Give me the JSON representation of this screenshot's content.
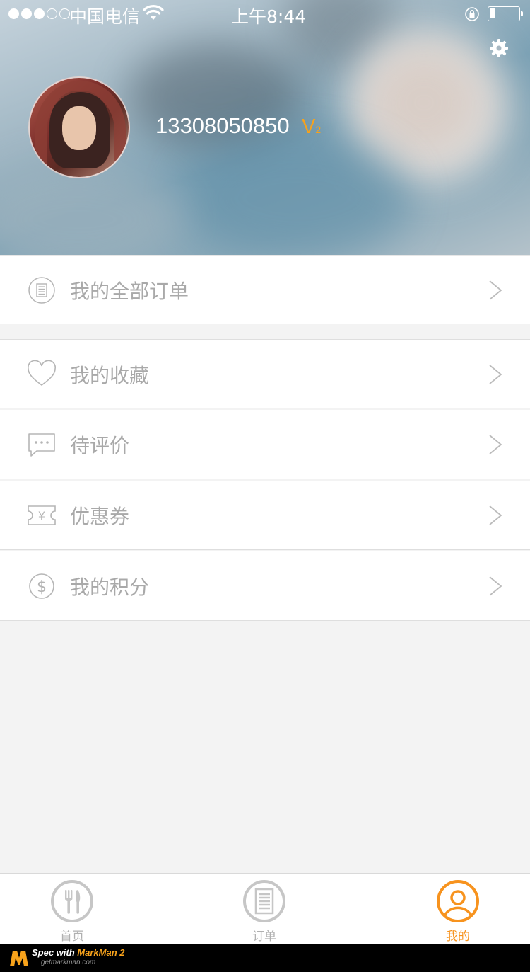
{
  "status_bar": {
    "carrier": "中国电信",
    "time": "上午8:44",
    "signal_bars_filled": 3,
    "signal_bars_total": 5,
    "battery_level": 0.2
  },
  "profile": {
    "phone": "13308050850",
    "vip_letter": "V",
    "vip_level": "2"
  },
  "menu": {
    "all_orders": "我的全部订单",
    "favorites": "我的收藏",
    "to_review": "待评价",
    "coupons": "优惠券",
    "points": "我的积分"
  },
  "tabs": {
    "home": "首页",
    "orders": "订单",
    "mine": "我的",
    "active": "mine"
  },
  "watermark": {
    "spec": "Spec with ",
    "brand": "MarkMan 2",
    "url": "getmarkman.com"
  },
  "colors": {
    "accent": "#f7931e",
    "text_muted": "#a9a9a9",
    "background": "#f3f3f3"
  },
  "icons": {
    "settings": "gear-icon",
    "orders": "document-icon",
    "favorites": "heart-icon",
    "review": "chat-bubble-icon",
    "coupon": "ticket-icon",
    "points": "dollar-coin-icon"
  }
}
